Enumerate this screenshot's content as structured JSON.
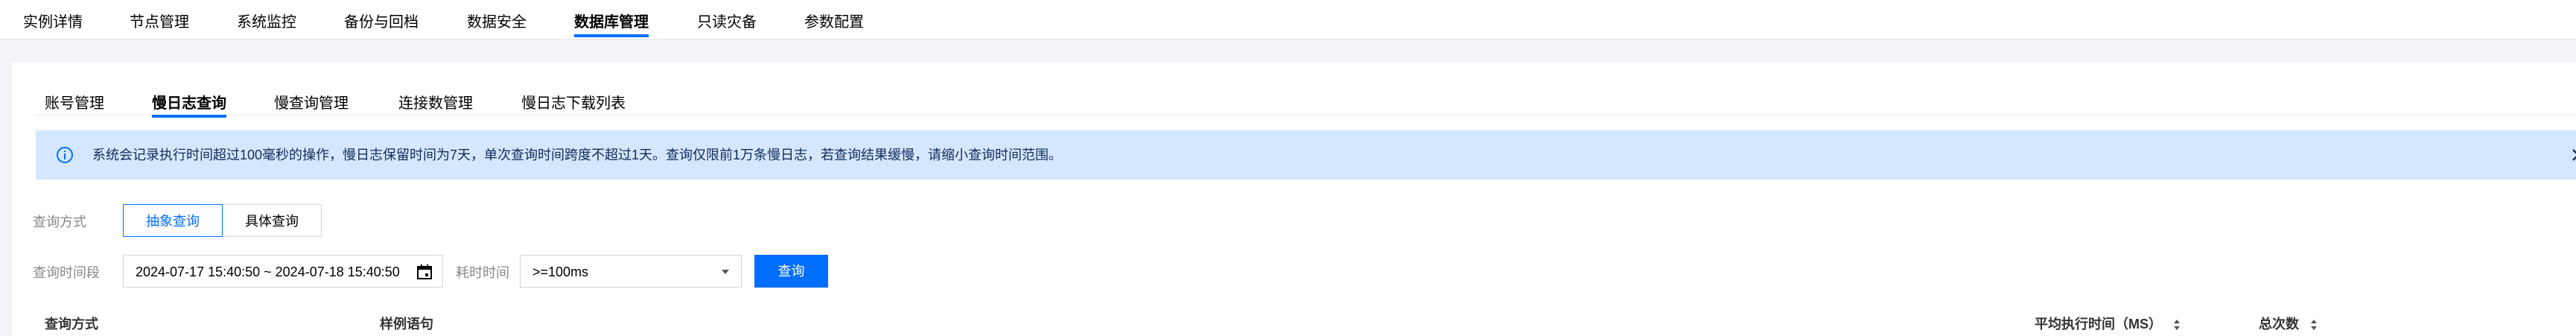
{
  "top_tabs": {
    "items": [
      {
        "label": "实例详情"
      },
      {
        "label": "节点管理"
      },
      {
        "label": "系统监控"
      },
      {
        "label": "备份与回档"
      },
      {
        "label": "数据安全"
      },
      {
        "label": "数据库管理",
        "active": true
      },
      {
        "label": "只读灾备"
      },
      {
        "label": "参数配置"
      }
    ]
  },
  "sub_tabs": {
    "items": [
      {
        "label": "账号管理"
      },
      {
        "label": "慢日志查询",
        "active": true
      },
      {
        "label": "慢查询管理"
      },
      {
        "label": "连接数管理"
      },
      {
        "label": "慢日志下载列表"
      }
    ]
  },
  "notice": {
    "text": "系统会记录执行时间超过100毫秒的操作，慢日志保留时间为7天，单次查询时间跨度不超过1天。查询仅限前1万条慢日志，若查询结果缓慢，请缩小查询时间范围。",
    "info_icon": "info-icon",
    "close_icon": "close-icon"
  },
  "form": {
    "mode_label": "查询方式",
    "mode_options": [
      "抽象查询",
      "具体查询"
    ],
    "mode_selected": "抽象查询",
    "range_label": "查询时间段",
    "range_value": "2024-07-17 15:40:50 ~ 2024-07-18 15:40:50",
    "duration_label": "耗时时间",
    "duration_value": ">=100ms",
    "query_button": "查询"
  },
  "table": {
    "columns": [
      {
        "label": "查询方式"
      },
      {
        "label": "样例语句"
      },
      {
        "label": "平均执行时间（MS）",
        "sortable": true
      },
      {
        "label": "总次数",
        "sortable": true
      }
    ]
  },
  "colors": {
    "accent": "#006eff",
    "notice_bg": "#d5e7ff",
    "page_bg": "#f3f4f7"
  }
}
